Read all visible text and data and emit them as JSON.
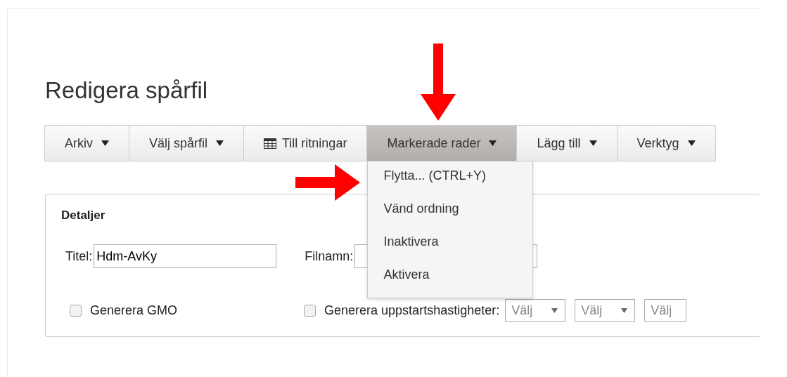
{
  "page_title": "Redigera spårfil",
  "toolbar": [
    {
      "label": "Arkiv",
      "kind": "dropdown",
      "selected": false
    },
    {
      "label": "Välj spårfil",
      "kind": "dropdown",
      "selected": false
    },
    {
      "label": "Till ritningar",
      "kind": "table",
      "selected": false
    },
    {
      "label": "Markerade rader",
      "kind": "dropdown",
      "selected": true
    },
    {
      "label": "Lägg till",
      "kind": "dropdown",
      "selected": false
    },
    {
      "label": "Verktyg",
      "kind": "dropdown",
      "selected": false
    }
  ],
  "menu": {
    "items": [
      "Flytta... (CTRL+Y)",
      "Vänd ordning",
      "Inaktivera",
      "Aktivera"
    ]
  },
  "details": {
    "heading": "Detaljer",
    "title_label": "Titel:",
    "title_value": "Hdm-AvKy",
    "filename_label": "Filnamn:",
    "gmo": {
      "label": "Generera GMO",
      "checked": false
    },
    "speeds": {
      "label": "Generera uppstartshastigheter:",
      "checked": false
    },
    "selects": [
      "Välj",
      "Välj",
      "Välj"
    ]
  }
}
